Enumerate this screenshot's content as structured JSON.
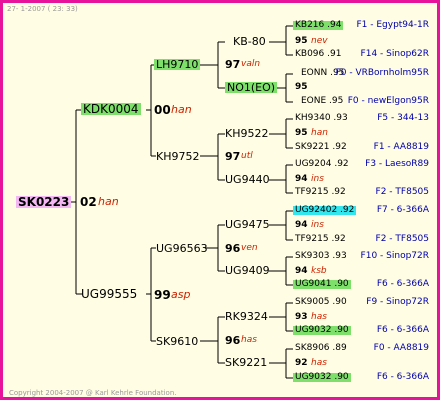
{
  "header": {
    "date": "27- 1-2007 ( 23: 33)"
  },
  "footer": {
    "copyright": "Copyright 2004-2007 @ Karl Kehrle Foundation."
  },
  "colors": {
    "frame": "#e8139b",
    "background": "#fffde3",
    "highlight_green": "#7ee06a",
    "highlight_cyan": "#33e6ee",
    "root_highlight": "#f3b8f3",
    "year_red": "#cc2200",
    "origin_blue": "#0000aa"
  },
  "root": {
    "id": "SK0223",
    "year": "02",
    "breed": "han"
  },
  "gen1": {
    "top": {
      "id": "KDK0004",
      "year": "00",
      "breed": "han"
    },
    "bottom": {
      "id": "UG99555",
      "year": "99",
      "breed": "asp"
    }
  },
  "gen2": {
    "a": {
      "id": "LH9710",
      "year": "97",
      "breed": "valn"
    },
    "b": {
      "id": "KH9752",
      "year": "97",
      "breed": "utl"
    },
    "c": {
      "id": "UG96563",
      "year": "96",
      "breed": "ven"
    },
    "d": {
      "id": "SK9610",
      "year": "96",
      "breed": "has"
    }
  },
  "gen3": {
    "a1": "KB-80",
    "a2": "NO1(EO)",
    "b1": "KH9522",
    "b2": "UG9440",
    "c1": "UG9475",
    "c2": "UG9409",
    "d1": "RK9324",
    "d2": "SK9221",
    "a1_year": "95",
    "a1_breed": "nev",
    "a2_year": "95",
    "a2_breed": "",
    "b1_year": "95",
    "b1_breed": "han",
    "b2_year": "94",
    "b2_breed": "ins",
    "c1_year": "94",
    "c1_breed": "ins",
    "c2_year": "94",
    "c2_breed": "ksb",
    "d1_year": "93",
    "d1_breed": "has",
    "d2_year": "92",
    "d2_breed": "has"
  },
  "gen4": [
    {
      "id": "KB216 .94",
      "origin": "F1 - Egypt94-1R"
    },
    {
      "id": "KB096 .91",
      "origin": "F14 - Sinop62R"
    },
    {
      "id": "EONN .95",
      "origin": "F0 - VRBornholm95R"
    },
    {
      "id": "EONE .95",
      "origin": "F0 - newElgon95R"
    },
    {
      "id": "KH9340 .93",
      "origin": "F5 - 344-13"
    },
    {
      "id": "SK9221 .92",
      "origin": "F1 - AA8819"
    },
    {
      "id": "UG9204 .92",
      "origin": "F3 - LaesoR89"
    },
    {
      "id": "TF9215 .92",
      "origin": "F2 - TF8505"
    },
    {
      "id": "UG92402 .92",
      "origin": "F7 - 6-366A"
    },
    {
      "id": "TF9215 .92",
      "origin": "F2 - TF8505"
    },
    {
      "id": "SK9303 .93",
      "origin": "F10 - Sinop72R"
    },
    {
      "id": "UG9041 .90",
      "origin": "F6 - 6-366A"
    },
    {
      "id": "SK9005 .90",
      "origin": "F9 - Sinop72R"
    },
    {
      "id": "UG9032 .90",
      "origin": "F6 - 6-366A"
    },
    {
      "id": "SK8906 .89",
      "origin": "F0 - AA8819"
    },
    {
      "id": "UG9032 .90",
      "origin": "F6 - 6-366A"
    }
  ]
}
